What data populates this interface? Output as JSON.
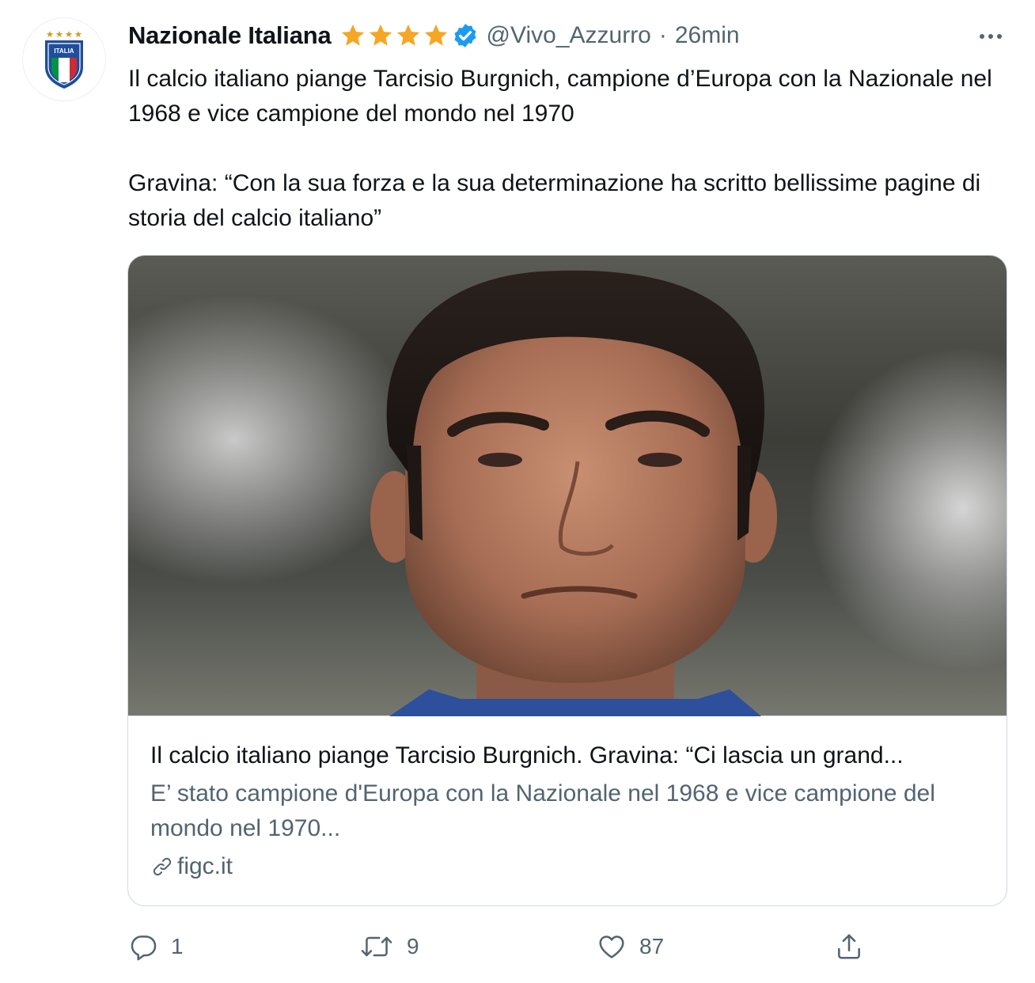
{
  "tweet": {
    "author": {
      "display_name": "Nazionale Italiana",
      "handle": "@Vivo_Azzurro",
      "verified": true,
      "avatar_icon": "figc-italia-crest-icon",
      "avatar_text": "ITALIA"
    },
    "separator": "·",
    "timestamp": "26min",
    "more_icon": "more-horizontal-icon",
    "text_paragraphs": [
      "Il calcio italiano piange Tarcisio Burgnich, campione d’Europa con la Nazionale nel 1968 e vice campione del mondo nel 1970",
      "Gravina: “Con la sua forza e la sua determinazione ha scritto bellissime pagine di storia del calcio italiano”"
    ],
    "card": {
      "title": "Il calcio italiano piange Tarcisio Burgnich. Gravina: “Ci lascia un grand...",
      "description": "E’ stato campione d'Europa con la Nazionale nel 1968 e vice campione del mondo nel 1970...",
      "domain": "figc.it",
      "link_icon": "link-icon",
      "image_icon": "player-portrait-photo"
    },
    "actions": {
      "reply": {
        "icon": "reply-icon",
        "count": "1"
      },
      "retweet": {
        "icon": "retweet-icon",
        "count": "9"
      },
      "like": {
        "icon": "heart-icon",
        "count": "87"
      },
      "share": {
        "icon": "share-icon",
        "count": ""
      }
    }
  },
  "colors": {
    "primary_text": "#0f1419",
    "secondary_text": "#536471",
    "border": "#cfd9de",
    "verified_blue": "#1d9bf0",
    "star_gold": "#f5a623",
    "italy_green": "#009246",
    "italy_red": "#ce2b37",
    "figc_blue": "#1f4e9a"
  }
}
